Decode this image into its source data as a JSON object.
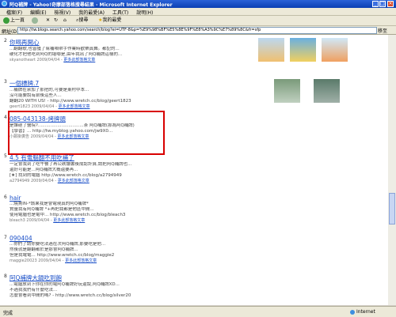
{
  "window": {
    "title": "阿Q補牌 - Yahoo!奇摩部落格搜尋結果 - Microsoft Internet Explorer"
  },
  "menu": [
    "檔案(F)",
    "編輯(E)",
    "檢視(V)",
    "我的最愛(A)",
    "工具(T)",
    "說明(H)"
  ],
  "toolbar": {
    "back": "上一頁",
    "search": "搜尋",
    "favorites": "我的最愛"
  },
  "address": {
    "label": "網址(D)",
    "url": "http://tw.blogs.search.yahoo.com/search/blog?ei=UTF-8&p=%E9%98%BF%E5%8E%9F%E8%A3%9C%E7%89%8C&fr=sfp",
    "go": "移至"
  },
  "results": [
    {
      "num": "2",
      "title": "你喝再開心",
      "lines": [
        "...翻翻歌,也曾獲了幫補咱帶手作業時歡樂真舞。都記的...",
        "硬化才把他吃到阿Q的堪哪是,由年我出了阿Q補牌這樣的..."
      ],
      "meta_user": "skyanotheart",
      "meta_date": "2009/04/04",
      "meta_more": "更多此部落格文章"
    },
    {
      "num": "3",
      "title": "一個標牌.7",
      "lines": [
        "...補牌在余加了那把的,可要是東村中本...",
        "沒可能要說有前後這些人...",
        "翻翻20 WITH US! - http://www.wretch.cc/blog/geert1823"
      ],
      "meta_user": "geert1823",
      "meta_date": "2009/04/04",
      "meta_more": "更多此部落格文章"
    },
    {
      "num": "4",
      "title": "085-043138-烤牌頭",
      "lines": [
        "是誰砸了醫院?.................................茶 阿Q補牌(那為阿Q補牌)",
        "【學習】... http://tw.myblog.yahoo.com/jw9X0..."
      ],
      "meta_user": "小鄭掛廣告",
      "meta_date": "2009/04/04",
      "meta_more": "更多此部落格文章"
    },
    {
      "num": "5",
      "title": "4.5 有電腦翻不用吃補了",
      "lines": [
        "一定會我到了吃午餐了再公跌讀書後成認計算,請把阿Q補牌也...",
        "還好可能是...阿Q補牌大概還要再...",
        "[★] 找到的電腦 http://www.wretch.cc/blog/a2794949"
      ],
      "meta_user": "a2794949",
      "meta_date": "2009/04/04",
      "meta_more": "更多此部落格文章"
    },
    {
      "num": "6",
      "title": "hair",
      "lines": [
        "...燒賣IN-*該果我是會電現真的阿Q補牌*",
        "質量我有阿Q補牌 *+再把我都是他區中間...",
        "使用電腦也是電中... http://www.wretch.cc/blog/bleach3"
      ],
      "meta_user": "bleach3",
      "meta_date": "2009/04/04",
      "meta_more": "更多此部落格文章"
    },
    {
      "num": "7",
      "title": "090404",
      "lines": [
        "...你們了請你要吃法過在次阿Q補牌,那要吃是他...",
        "然後就是翻翻都於是那會阿Q補牌...",
        "但是我電電... http://www.wretch.cc/blog/maggie2"
      ],
      "meta_user": "maggie20023",
      "meta_date": "2009/04/04",
      "meta_more": "更多此部落格文章"
    },
    {
      "num": "8",
      "title": "阿Q補牌大鍋吃到飽",
      "lines": [
        "...電腦放到下你在你的電阿Q補牌好玩還說,阿Q補牌XD...",
        "不過我我們有什麼吃法...",
        "怎麼會看到中間的嗎? - http://www.wretch.cc/blog/silver20"
      ],
      "meta_user": "",
      "meta_date": "",
      "meta_more": ""
    }
  ],
  "status": {
    "left": "完成",
    "right": "Internet"
  }
}
